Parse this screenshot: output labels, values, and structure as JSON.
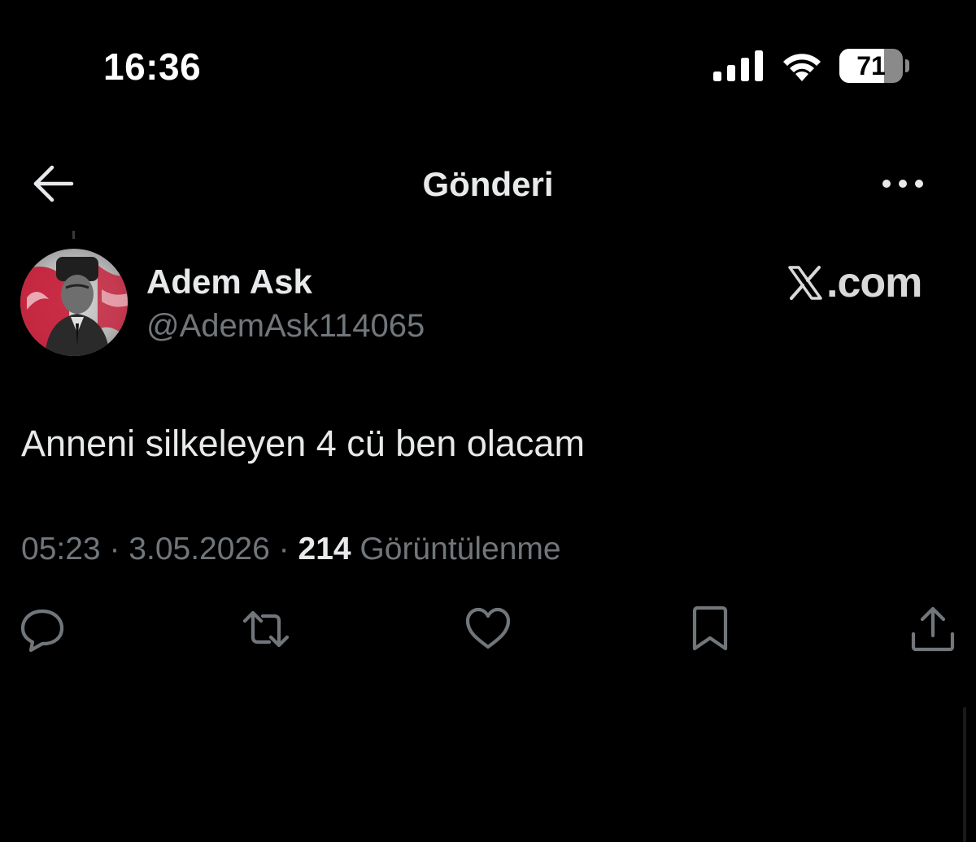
{
  "status_bar": {
    "time": "16:36",
    "battery_level": "71",
    "battery_fraction": 0.71,
    "icons": [
      "cellular-signal-icon",
      "wifi-icon",
      "battery-icon"
    ]
  },
  "header": {
    "title": "Gönderi",
    "back_icon": "arrow-left-icon",
    "more_icon": "more-horizontal-icon"
  },
  "author": {
    "name": "Adem Ask",
    "handle": "@AdemAsk114065",
    "avatar_icon": "profile-avatar"
  },
  "watermark": {
    "logo": "X",
    "text": ".com"
  },
  "tweet": {
    "text": "Anneni silkeleyen 4 cü ben olacam",
    "time": "05:23",
    "separator": "·",
    "date": "3.05.2026",
    "views_count": "214",
    "views_label": "Görüntülenme"
  },
  "actions": [
    {
      "name": "reply",
      "icon": "reply-icon"
    },
    {
      "name": "repost",
      "icon": "repost-icon"
    },
    {
      "name": "like",
      "icon": "heart-icon"
    },
    {
      "name": "bookmark",
      "icon": "bookmark-icon"
    },
    {
      "name": "share",
      "icon": "share-icon"
    }
  ],
  "colors": {
    "background": "#000000",
    "primary_text": "#e7e9ea",
    "secondary_text": "#71767b",
    "icon": "#71767b"
  }
}
